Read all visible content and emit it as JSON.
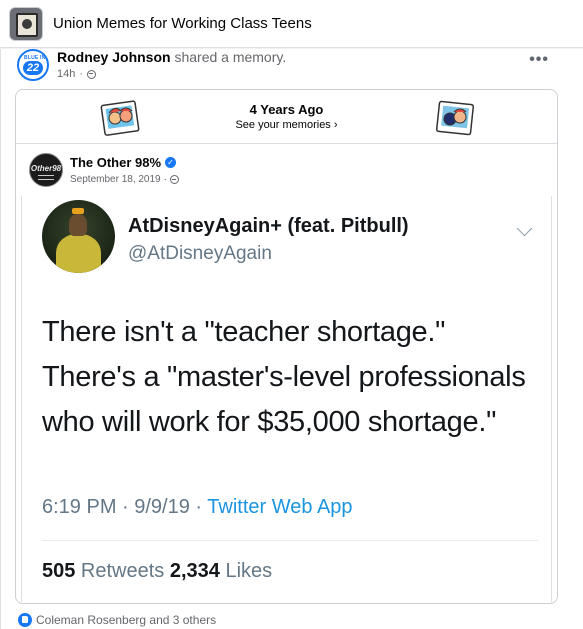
{
  "group": {
    "name": "Union Memes for Working Class Teens"
  },
  "post": {
    "author": "Rodney Johnson",
    "action": "shared a memory.",
    "time": "14h",
    "avatar_badge_top": "BLUE IN",
    "avatar_badge_number": "22",
    "more_menu": "•••"
  },
  "memory": {
    "title": "4 Years Ago",
    "link": "See your memories"
  },
  "shared_page": {
    "name": "The Other 98%",
    "date": "September 18, 2019",
    "avatar_text": "Other98"
  },
  "tweet": {
    "display_name": "AtDisneyAgain+ (feat. Pitbull)",
    "handle": "@AtDisneyAgain",
    "lines": [
      "There isn't a \"teacher shortage.\"",
      "There's a \"master's-level professionals",
      "who will work for $35,000 shortage.\""
    ],
    "time": "6:19 PM · 9/9/19 · ",
    "source": "Twitter Web App",
    "retweets_count": "505",
    "retweets_label": " Retweets ",
    "likes_count": "2,334",
    "likes_label": " Likes"
  },
  "reactions": {
    "text": "Coleman Rosenberg and 3 others"
  },
  "colors": {
    "facebook_blue": "#1877f2",
    "twitter_link": "#1b95e0",
    "muted": "#65676b"
  },
  "icons": [
    "globe-icon",
    "verified-icon",
    "chevron-down-icon",
    "like-icon",
    "more-icon"
  ]
}
